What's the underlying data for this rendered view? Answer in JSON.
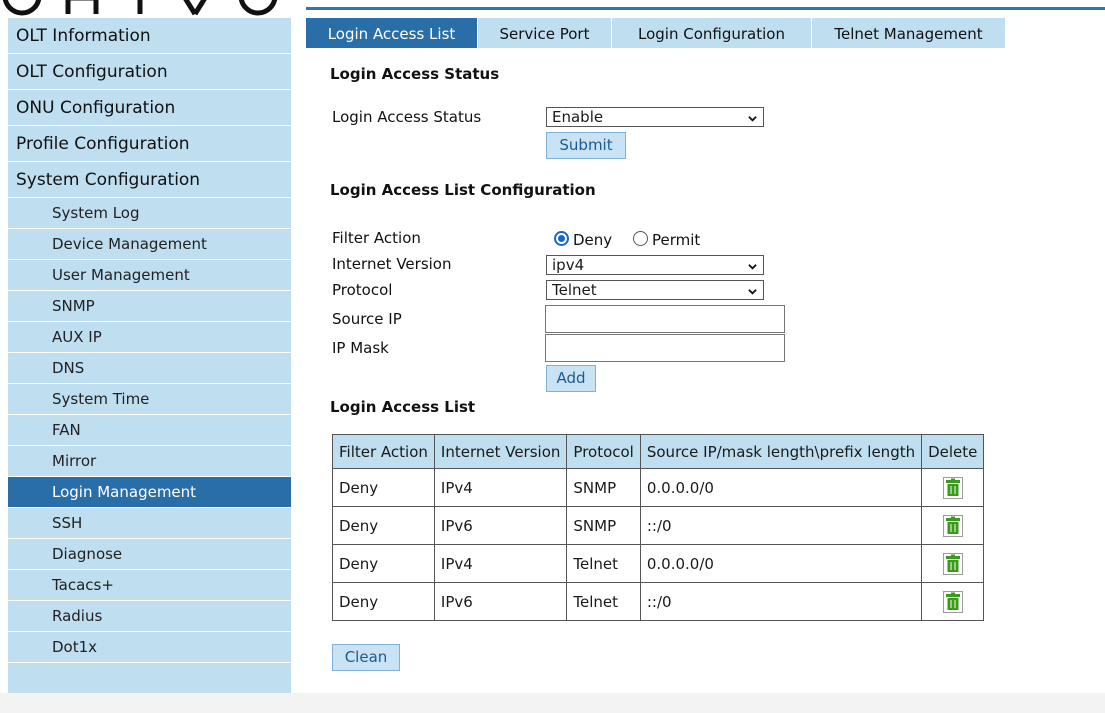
{
  "sidebar": {
    "main_items": [
      {
        "label": "OLT Information"
      },
      {
        "label": "OLT Configuration"
      },
      {
        "label": "ONU Configuration"
      },
      {
        "label": "Profile Configuration"
      },
      {
        "label": "System Configuration"
      }
    ],
    "sub_items": [
      {
        "label": "System Log"
      },
      {
        "label": "Device Management"
      },
      {
        "label": "User Management"
      },
      {
        "label": "SNMP"
      },
      {
        "label": "AUX IP"
      },
      {
        "label": "DNS"
      },
      {
        "label": "System Time"
      },
      {
        "label": "FAN"
      },
      {
        "label": "Mirror"
      },
      {
        "label": "Login Management",
        "active": true
      },
      {
        "label": "SSH"
      },
      {
        "label": "Diagnose"
      },
      {
        "label": "Tacacs+"
      },
      {
        "label": "Radius"
      },
      {
        "label": "Dot1x"
      }
    ]
  },
  "tabs": [
    {
      "label": "Login Access List",
      "active": true
    },
    {
      "label": "Service Port"
    },
    {
      "label": "Login Configuration"
    },
    {
      "label": "Telnet Management"
    }
  ],
  "status_section": {
    "title": "Login Access Status",
    "field_label": "Login Access Status",
    "select_value": "Enable",
    "submit_label": "Submit"
  },
  "config_section": {
    "title": "Login Access List Configuration",
    "filter_action_label": "Filter Action",
    "filter_options": [
      "Deny",
      "Permit"
    ],
    "filter_selected": "Deny",
    "internet_version_label": "Internet Version",
    "internet_version_value": "ipv4",
    "protocol_label": "Protocol",
    "protocol_value": "Telnet",
    "source_ip_label": "Source IP",
    "source_ip_value": "",
    "ip_mask_label": "IP Mask",
    "ip_mask_value": "",
    "add_label": "Add"
  },
  "list_section": {
    "title": "Login Access List",
    "columns": [
      "Filter Action",
      "Internet Version",
      "Protocol",
      "Source IP/mask length\\prefix length",
      "Delete"
    ],
    "rows": [
      {
        "action": "Deny",
        "version": "IPv4",
        "protocol": "SNMP",
        "source": "0.0.0.0/0"
      },
      {
        "action": "Deny",
        "version": "IPv6",
        "protocol": "SNMP",
        "source": "::/0"
      },
      {
        "action": "Deny",
        "version": "IPv4",
        "protocol": "Telnet",
        "source": "0.0.0.0/0"
      },
      {
        "action": "Deny",
        "version": "IPv6",
        "protocol": "Telnet",
        "source": "::/0"
      }
    ],
    "delete_icon": "trash-icon",
    "clean_label": "Clean"
  },
  "colors": {
    "accent": "#2a6ea8",
    "nav_bg": "#bfdff1",
    "button_bg": "#c9e3f5",
    "trash_green": "#3a9a1e"
  }
}
